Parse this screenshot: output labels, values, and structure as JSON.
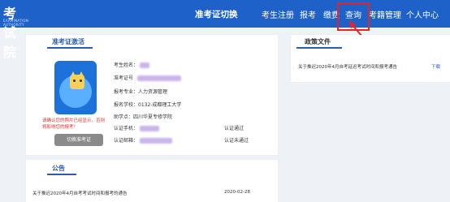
{
  "header": {
    "logo_text": "考试院",
    "logo_sub": "EXAMINATION AUTHORITY",
    "nav": [
      {
        "label": "准考证切换",
        "active": true
      },
      {
        "label": "考生注册",
        "active": false
      },
      {
        "label": "报考",
        "active": false
      },
      {
        "label": "缴费",
        "active": false
      },
      {
        "label": "查询",
        "active": false
      },
      {
        "label": "考籍管理",
        "active": false
      },
      {
        "label": "个人中心",
        "active": false
      }
    ]
  },
  "admission_panel": {
    "title": "准考证激活",
    "warning": "请确认您的照片已经显示，否则将影响您的报考！",
    "switch_button": "切换准考证",
    "fields": {
      "name_label": "考生姓名：",
      "ticket_label": "准考证号",
      "major": "报考专业：人力资源管理",
      "school": "报名学校：0132-成都理工大学",
      "assist_school": "助学点：四川华夏专修学院",
      "phone_label": "认证手机：",
      "phone_status": "认证通过",
      "email_label": "认证邮箱：",
      "email_status": "认证未通过"
    }
  },
  "policy_panel": {
    "title": "政策文件",
    "item_text": "关于推迟2020年4月自考延迟考试时间和报考通告",
    "item_link": "下载"
  },
  "notice_panel": {
    "title": "公告",
    "item_text": "关于推迟2020年4月自考考试时间和报考的通告",
    "item_date": "2020-02-28"
  },
  "colors": {
    "header_bg": "#1e62c9",
    "accent": "#2a5db0",
    "highlight": "#e0262b",
    "warning": "#e03030"
  }
}
